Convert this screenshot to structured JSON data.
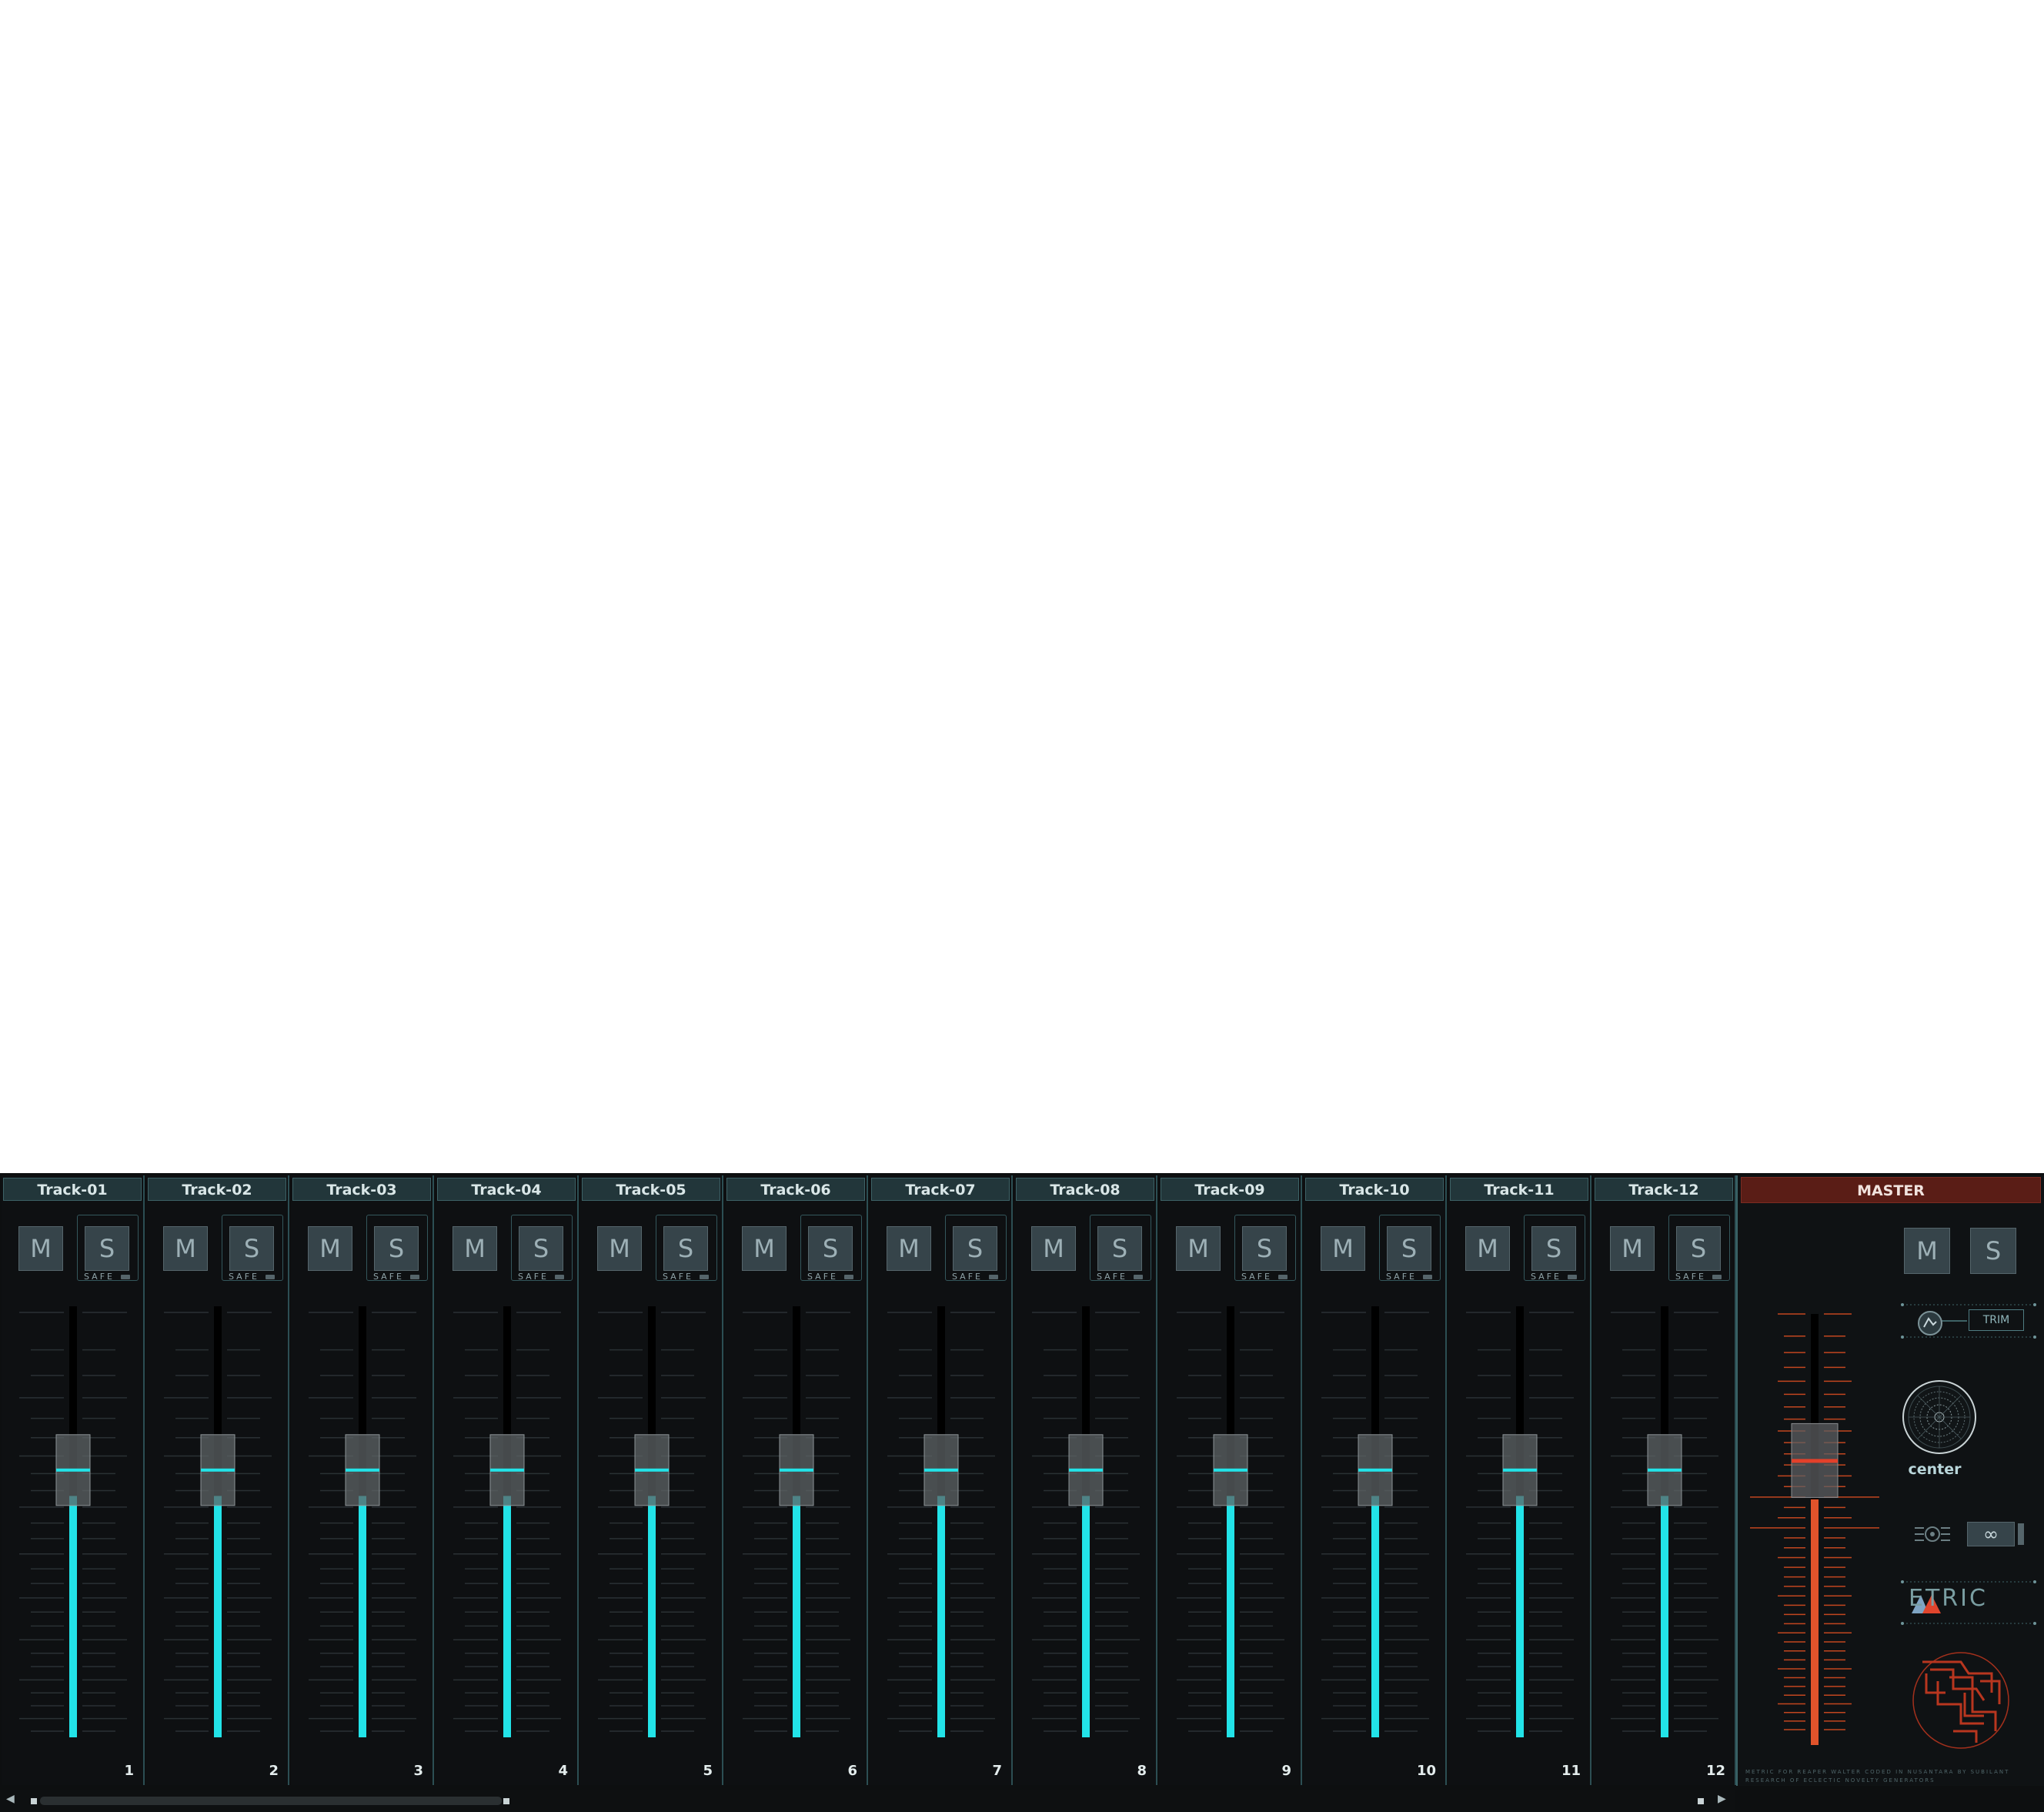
{
  "mixer": {
    "tracks": [
      {
        "name": "Track-01",
        "number": "1",
        "mute": "M",
        "solo": "S",
        "safe": "SAFE"
      },
      {
        "name": "Track-02",
        "number": "2",
        "mute": "M",
        "solo": "S",
        "safe": "SAFE"
      },
      {
        "name": "Track-03",
        "number": "3",
        "mute": "M",
        "solo": "S",
        "safe": "SAFE"
      },
      {
        "name": "Track-04",
        "number": "4",
        "mute": "M",
        "solo": "S",
        "safe": "SAFE"
      },
      {
        "name": "Track-05",
        "number": "5",
        "mute": "M",
        "solo": "S",
        "safe": "SAFE"
      },
      {
        "name": "Track-06",
        "number": "6",
        "mute": "M",
        "solo": "S",
        "safe": "SAFE"
      },
      {
        "name": "Track-07",
        "number": "7",
        "mute": "M",
        "solo": "S",
        "safe": "SAFE"
      },
      {
        "name": "Track-08",
        "number": "8",
        "mute": "M",
        "solo": "S",
        "safe": "SAFE"
      },
      {
        "name": "Track-09",
        "number": "9",
        "mute": "M",
        "solo": "S",
        "safe": "SAFE"
      },
      {
        "name": "Track-10",
        "number": "10",
        "mute": "M",
        "solo": "S",
        "safe": "SAFE"
      },
      {
        "name": "Track-11",
        "number": "11",
        "mute": "M",
        "solo": "S",
        "safe": "SAFE"
      },
      {
        "name": "Track-12",
        "number": "12",
        "mute": "M",
        "solo": "S",
        "safe": "SAFE"
      }
    ],
    "fader_level": 0.62,
    "meter_level": 0.56
  },
  "master": {
    "title": "MASTER",
    "mute": "M",
    "solo": "S",
    "trim": "TRIM",
    "pan": "center",
    "link": "∞",
    "logo": "ETRIC",
    "credit": "METRIC FOR REAPER WALTER CODED IN NUSANTARA BY SUBILANT RESEARCH OF ECLECTIC NOVELTY GENERATORS",
    "fader_level": 0.66,
    "meter_level": 0.57
  },
  "scrollbar": {
    "left_arrow": "◀",
    "right_arrow": "▶"
  },
  "colors": {
    "track_meter": "#22e3e8",
    "master_meter": "#e0532b",
    "header_bg": "#22363a",
    "master_header_bg": "#5a1d16"
  },
  "icons": [
    "envelope-icon",
    "pan-knob-icon",
    "gear-icon",
    "link-icon",
    "metric-logo-icon",
    "emblem-icon"
  ]
}
